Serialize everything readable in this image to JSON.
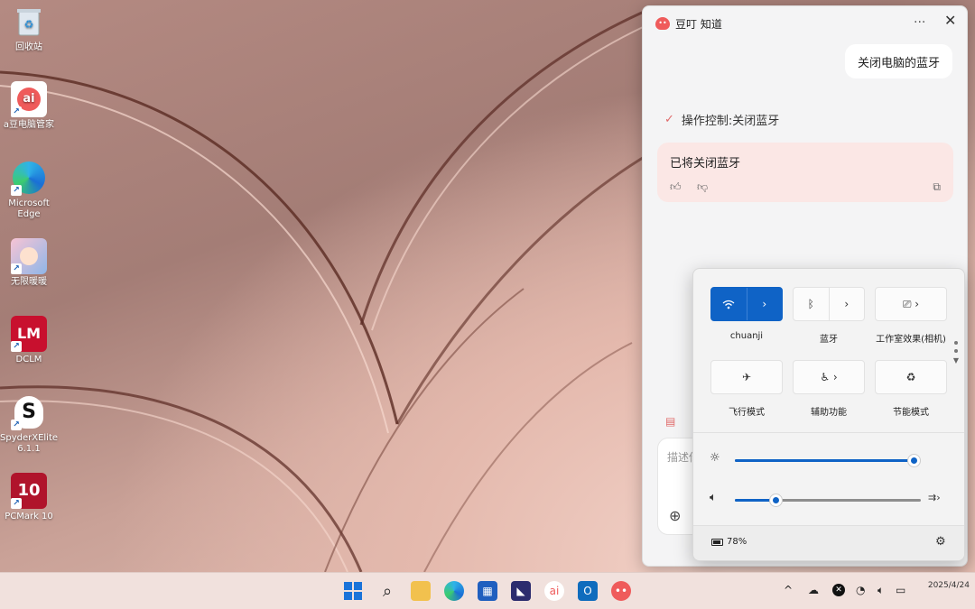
{
  "desktop": {
    "icons": [
      {
        "label": "回收站",
        "icon": "recycle-bin-icon"
      },
      {
        "label": "a豆电脑管家",
        "icon": "adou-pc-manager-icon"
      },
      {
        "label": "Microsoft Edge",
        "icon": "edge-icon"
      },
      {
        "label": "无限暖暖",
        "icon": "infinity-nikki-icon"
      },
      {
        "label": "DCLM",
        "icon": "dclm-icon"
      },
      {
        "label": "SpyderXElite 6.1.1",
        "icon": "spyderx-icon"
      },
      {
        "label": "PCMark 10",
        "icon": "pcmark-icon"
      }
    ]
  },
  "chat": {
    "title": "豆叮 知道",
    "more_label": "···",
    "close_label": "✕",
    "user_message": "关闭电脑的蓝牙",
    "action": "操作控制:关闭蓝牙",
    "reply": "已将关闭蓝牙",
    "input_placeholder": "描述你",
    "accent": "#e06b6b"
  },
  "quick_settings": {
    "tiles": [
      {
        "label": "chuanji",
        "icon": "wifi-icon",
        "on": true
      },
      {
        "label": "蓝牙",
        "icon": "bluetooth-icon",
        "on": false
      },
      {
        "label": "工作室效果(相机)",
        "icon": "camera-effects-icon",
        "on": false
      },
      {
        "label": "飞行模式",
        "icon": "airplane-icon",
        "on": false
      },
      {
        "label": "辅助功能",
        "icon": "accessibility-icon",
        "on": false
      },
      {
        "label": "节能模式",
        "icon": "energy-saver-icon",
        "on": false
      }
    ],
    "brightness": 1.0,
    "volume": 0.22,
    "battery": "78%",
    "accent": "#0f63c6"
  },
  "taskbar": {
    "apps": [
      "start-icon",
      "search-icon",
      "file-explorer-icon",
      "edge-icon",
      "store-icon",
      "vs-code-icon",
      "adou-icon",
      "outlook-icon",
      "doudou-icon"
    ],
    "date": "2025/4/24"
  }
}
